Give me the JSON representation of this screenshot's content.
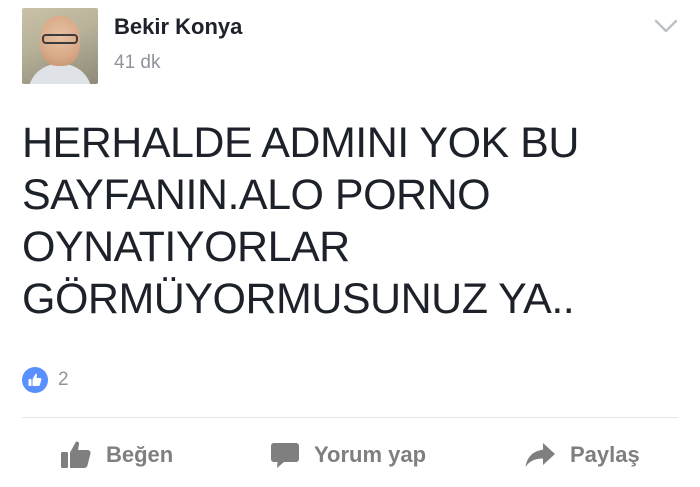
{
  "post": {
    "author": "Bekir Konya",
    "time": "41 dk",
    "text_lines": [
      "HERHALDE ADMINI YOK BU",
      "SAYFANIN.ALO PORNO",
      "OYNATIYORLAR",
      "GÖRMÜYORMUSUNUZ YA.."
    ],
    "reaction_count": "2"
  },
  "actions": {
    "like_label": "Beğen",
    "comment_label": "Yorum yap",
    "share_label": "Paylaş"
  },
  "icons": {
    "menu": "chevron-down-icon",
    "reaction": "like-reaction-icon",
    "like": "thumbs-up-icon",
    "comment": "speech-bubble-icon",
    "share": "share-arrow-icon"
  },
  "colors": {
    "text": "#1d2129",
    "meta": "#90949c",
    "action": "#7f7f7f",
    "like_blue": "#5890ff",
    "divider": "#e5e6e9"
  }
}
